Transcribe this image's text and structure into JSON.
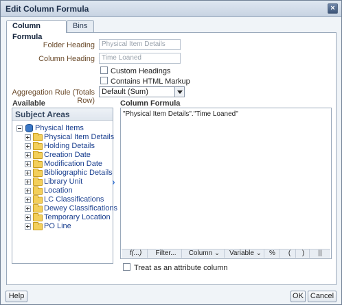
{
  "dialog": {
    "title": "Edit Column Formula",
    "close_symbol": "×"
  },
  "tabs": [
    {
      "label": "Column Formula",
      "active": true
    },
    {
      "label": "Bins",
      "active": false
    }
  ],
  "fields": {
    "folder_heading_label": "Folder Heading",
    "folder_heading_value": "Physical Item Details",
    "column_heading_label": "Column Heading",
    "column_heading_value": "Time Loaned",
    "custom_headings_label": "Custom Headings",
    "custom_headings_checked": false,
    "html_markup_label": "Contains HTML Markup",
    "html_markup_checked": false,
    "aggregation_label": "Aggregation Rule (Totals Row)",
    "aggregation_value": "Default (Sum)"
  },
  "available": {
    "heading": "Available",
    "panel_title": "Subject Areas",
    "root": "Physical Items",
    "items": [
      "Physical Item Details",
      "Holding Details",
      "Creation Date",
      "Modification Date",
      "Bibliographic Details",
      "Library Unit",
      "Location",
      "LC Classifications",
      "Dewey Classifications",
      "Temporary Location",
      "PO Line"
    ]
  },
  "formula": {
    "heading": "Column Formula",
    "text": "\"Physical Item Details\".\"Time Loaned\"",
    "toolbar": {
      "fx": "f(...)",
      "filter": "Filter...",
      "column": "Column ⌄",
      "variable": "Variable ⌄",
      "percent": "%",
      "open_paren": "(",
      "close_paren": ")",
      "concat": "||"
    },
    "treat_attribute_label": "Treat as an attribute column",
    "treat_attribute_checked": false
  },
  "footer": {
    "help": "Help",
    "ok": "OK",
    "cancel": "Cancel"
  },
  "colors": {
    "link": "#1a3f8f",
    "accent": "#3d78d6",
    "label": "#6b4b2b"
  }
}
